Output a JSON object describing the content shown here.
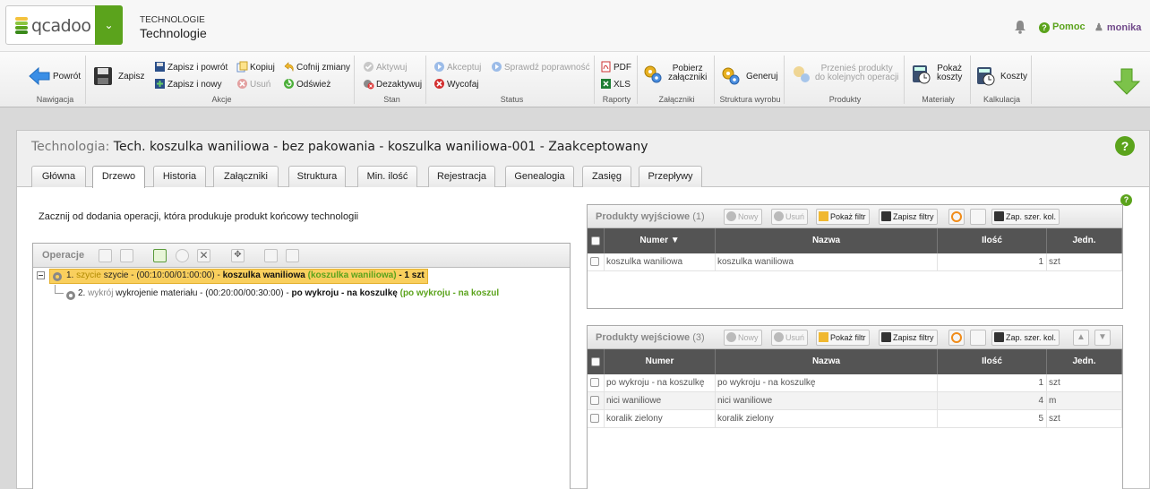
{
  "app": {
    "brand": "qcadoo",
    "section_caps": "TECHNOLOGIE",
    "section": "Technologie",
    "help_label": "Pomoc",
    "user": "monika"
  },
  "ribbon": {
    "back": "Powrót",
    "save": "Zapisz",
    "save_back": "Zapisz i powrót",
    "save_new": "Zapisz i nowy",
    "copy": "Kopiuj",
    "delete": "Usuń",
    "undo": "Cofnij zmiany",
    "refresh": "Odśwież",
    "activate": "Aktywuj",
    "deactivate": "Dezaktywuj",
    "accept": "Akceptuj",
    "check": "Sprawdź poprawność",
    "withdraw": "Wycofaj",
    "pdf": "PDF",
    "xls": "XLS",
    "download_att_1": "Pobierz",
    "download_att_2": "załączniki",
    "generate": "Generuj",
    "move_prod_1": "Przenieś produkty",
    "move_prod_2": "do kolejnych operacji",
    "show_costs_1": "Pokaż",
    "show_costs_2": "koszty",
    "costs": "Koszty",
    "groups": {
      "nav": "Nawigacja",
      "actions": "Akcje",
      "state": "Stan",
      "status": "Status",
      "reports": "Raporty",
      "attachments": "Załączniki",
      "structure": "Struktura wyrobu",
      "products": "Produkty",
      "materials": "Materiały",
      "calc": "Kalkulacja"
    }
  },
  "panel": {
    "title_prefix": "Technologia:",
    "title": "Tech. koszulka waniliowa - bez pakowania - koszulka waniliowa-001 - Zaakceptowany",
    "help": "?",
    "tabs": [
      "Główna",
      "Drzewo",
      "Historia",
      "Załączniki",
      "Struktura",
      "Min. ilość",
      "Rejestracja",
      "Genealogia",
      "Zasięg",
      "Przepływy"
    ],
    "hint": "Zacznij od dodania operacji, która produkuje produkt końcowy technologii"
  },
  "tree": {
    "label": "Operacje",
    "nodes": [
      {
        "num": "1.",
        "code": "szycie",
        "name": "szycie - (00:10:00/01:00:00) -",
        "product": "koszulka waniliowa",
        "pcode": "(koszulka waniliowa)",
        "qty": "- 1 szt"
      },
      {
        "num": "2.",
        "code": "wykrój",
        "name": "wykrojenie materiału - (00:20:00/00:30:00) -",
        "product": "po wykroju - na koszulkę",
        "pcode": "(po wykroju - na koszul",
        "qty": ""
      }
    ]
  },
  "grid_buttons": {
    "new": "Nowy",
    "delete": "Usuń",
    "show_filter": "Pokaż filtr",
    "save_filters": "Zapisz filtry",
    "save_widths": "Zap. szer. kol."
  },
  "output_grid": {
    "title": "Produkty wyjściowe",
    "count": "(1)",
    "columns": [
      "Numer",
      "Nazwa",
      "Ilość",
      "Jedn."
    ],
    "rows": [
      {
        "number": "koszulka waniliowa",
        "name": "koszulka waniliowa",
        "qty": "1",
        "unit": "szt"
      }
    ]
  },
  "input_grid": {
    "title": "Produkty wejściowe",
    "count": "(3)",
    "columns": [
      "Numer",
      "Nazwa",
      "Ilość",
      "Jedn."
    ],
    "rows": [
      {
        "number": "po wykroju - na koszulkę",
        "name": "po wykroju - na koszulkę",
        "qty": "1",
        "unit": "szt"
      },
      {
        "number": "nici waniliowe",
        "name": "nici waniliowe",
        "qty": "4",
        "unit": "m"
      },
      {
        "number": "koralik zielony",
        "name": "koralik zielony",
        "qty": "5",
        "unit": "szt"
      }
    ]
  },
  "colors": {
    "accent_green": "#5ba31c",
    "selected_node": "#f9cf5d",
    "grid_header": "#545454",
    "user_purple": "#70498a"
  }
}
